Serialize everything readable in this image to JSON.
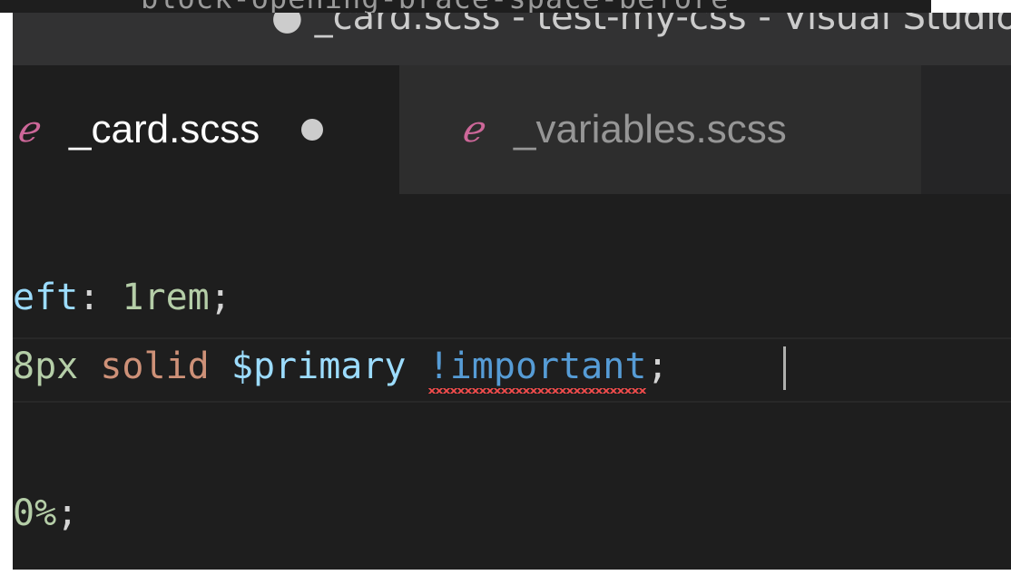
{
  "hover_tooltip": {
    "text": "block-opening-brace-space-before"
  },
  "window": {
    "title": "● _card.scss - test-my-css - Visual Studio Code"
  },
  "tabs": [
    {
      "label": "_card.scss",
      "icon": "sass-icon",
      "active": true,
      "dirty": true
    },
    {
      "label": "_variables.scss",
      "icon": "sass-icon",
      "active": false,
      "dirty": false
    }
  ],
  "editor": {
    "lines": [
      {
        "tokens": {
          "prop": "eft",
          "colon": ": ",
          "value": "1rem",
          "semi": ";"
        }
      },
      {
        "tokens": {
          "num": "8px",
          "space1": " ",
          "str": "solid",
          "space2": " ",
          "var": "$primary",
          "space3": " ",
          "kw": "!important",
          "semi": ";"
        },
        "error_underline_on": "!important"
      },
      {
        "tokens": {}
      },
      {
        "tokens": {
          "num": "0%",
          "semi": ";"
        }
      }
    ]
  },
  "colors": {
    "editor_bg": "#1e1e1e",
    "titlebar_bg": "#323233",
    "tab_inactive_bg": "#2d2d2d",
    "sass_icon": "#cd6799",
    "property": "#9cdcfe",
    "number": "#b5cea8",
    "string": "#ce9178",
    "keyword": "#569cd6",
    "error_squiggle": "#f14c4c"
  }
}
